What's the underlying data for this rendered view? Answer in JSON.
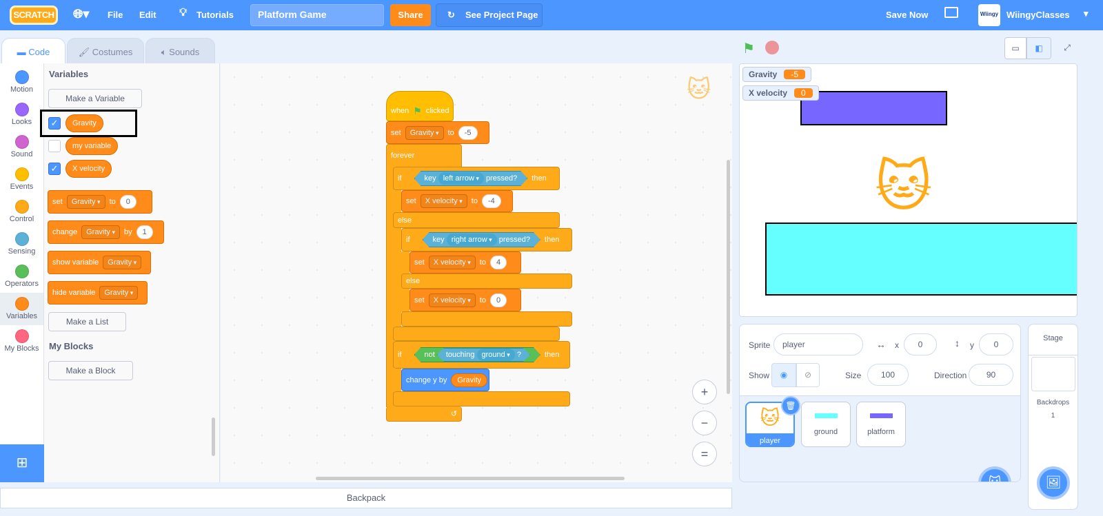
{
  "topbar": {
    "logo": "SCRATCH",
    "language_icon": "globe-icon",
    "file": "File",
    "edit": "Edit",
    "tutorials": "Tutorials",
    "project_title": "Platform Game",
    "share": "Share",
    "see_project_page": "See Project Page",
    "save_now": "Save Now",
    "username": "WiingyClasses",
    "avatar_text": "Wiingy"
  },
  "tabs": [
    {
      "label": "Code",
      "active": true
    },
    {
      "label": "Costumes"
    },
    {
      "label": "Sounds"
    }
  ],
  "categories": [
    {
      "label": "Motion",
      "color": "#4C97FF"
    },
    {
      "label": "Looks",
      "color": "#9966FF"
    },
    {
      "label": "Sound",
      "color": "#CF63CF"
    },
    {
      "label": "Events",
      "color": "#FFBF00"
    },
    {
      "label": "Control",
      "color": "#FFAB19"
    },
    {
      "label": "Sensing",
      "color": "#5CB1D6"
    },
    {
      "label": "Operators",
      "color": "#59C059"
    },
    {
      "label": "Variables",
      "color": "#FF8C1A",
      "active": true
    },
    {
      "label": "My Blocks",
      "color": "#FF6680"
    }
  ],
  "palette": {
    "variables_heading": "Variables",
    "make_variable": "Make a Variable",
    "variables": [
      {
        "name": "Gravity",
        "checked": true,
        "highlighted": true
      },
      {
        "name": "my variable",
        "checked": false
      },
      {
        "name": "X velocity",
        "checked": true
      }
    ],
    "set_block": {
      "op": "set",
      "var": "Gravity",
      "to": "to",
      "value": "0"
    },
    "change_block": {
      "op": "change",
      "var": "Gravity",
      "by": "by",
      "value": "1"
    },
    "show_block": {
      "op": "show variable",
      "var": "Gravity"
    },
    "hide_block": {
      "op": "hide variable",
      "var": "Gravity"
    },
    "make_list": "Make a List",
    "myblocks_heading": "My Blocks",
    "make_block": "Make a Block"
  },
  "script": {
    "hat": {
      "when": "when",
      "clicked": "clicked"
    },
    "set_gravity": {
      "op": "set",
      "var": "Gravity",
      "to": "to",
      "value": "-5"
    },
    "forever": "forever",
    "if1": {
      "if": "if",
      "key": "key",
      "keyname": "left arrow",
      "pressed": "pressed?",
      "then": "then"
    },
    "set_xv1": {
      "op": "set",
      "var": "X velocity",
      "to": "to",
      "value": "-4"
    },
    "else": "else",
    "if2": {
      "if": "if",
      "key": "key",
      "keyname": "right arrow",
      "pressed": "pressed?",
      "then": "then"
    },
    "set_xv2": {
      "op": "set",
      "var": "X velocity",
      "to": "to",
      "value": "4"
    },
    "set_xv3": {
      "op": "set",
      "var": "X velocity",
      "to": "to",
      "value": "0"
    },
    "if3": {
      "if": "if",
      "not": "not",
      "touching": "touching",
      "target": "ground",
      "q": "?",
      "then": "then"
    },
    "change_y": {
      "op": "change y by",
      "var": "Gravity"
    }
  },
  "zoom": {
    "in": "+",
    "out": "−",
    "reset": "="
  },
  "backpack": "Backpack",
  "stage": {
    "monitors": [
      {
        "name": "Gravity",
        "value": "-5"
      },
      {
        "name": "X velocity",
        "value": "0"
      }
    ],
    "platform_color": "#7766FF",
    "ground_color": "#66FFFF"
  },
  "sprite_info": {
    "sprite_label": "Sprite",
    "sprite_name": "player",
    "x_label": "x",
    "x": "0",
    "y_label": "y",
    "y": "0",
    "show_label": "Show",
    "size_label": "Size",
    "size": "100",
    "direction_label": "Direction",
    "direction": "90"
  },
  "sprites": [
    {
      "name": "player",
      "selected": true
    },
    {
      "name": "ground"
    },
    {
      "name": "platform"
    }
  ],
  "stage_panel": {
    "title": "Stage",
    "backdrops_label": "Backdrops",
    "backdrops": "1"
  }
}
